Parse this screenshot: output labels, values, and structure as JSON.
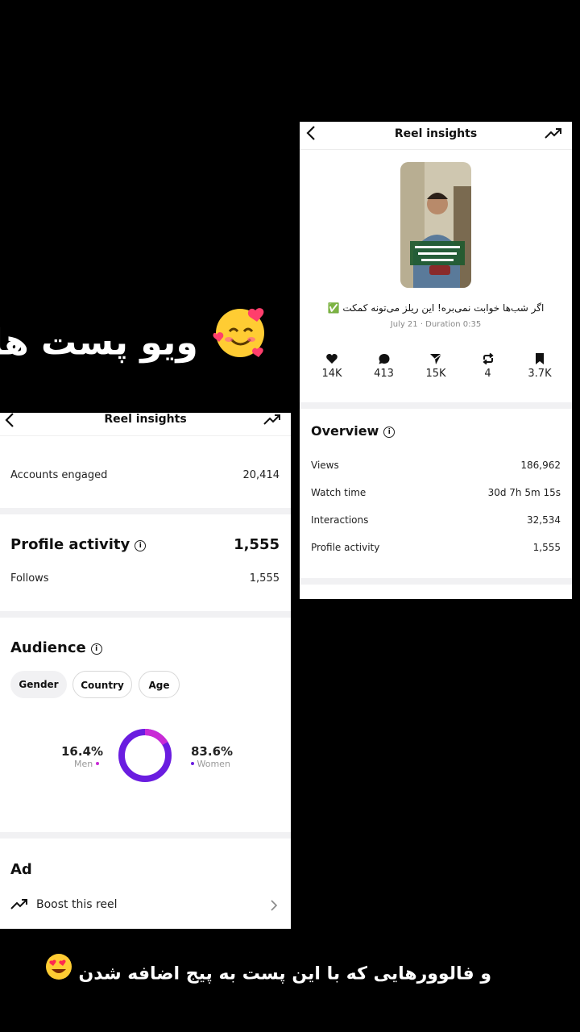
{
  "overlay": {
    "top_caption": "ویو پست ها",
    "bottom_caption": "و فالوورهایی که با این پست به پیج اضافه شدن"
  },
  "right_card": {
    "title": "Reel insights",
    "reel_caption": "اگر شب‌ها خوابت نمی‌بره! این ریلز می‌تونه کمکت ✅",
    "reel_meta": "July 21 · Duration 0:35",
    "metrics": [
      {
        "icon": "heart-icon",
        "value": "14K"
      },
      {
        "icon": "comment-icon",
        "value": "413"
      },
      {
        "icon": "share-icon",
        "value": "15K"
      },
      {
        "icon": "repost-icon",
        "value": "4"
      },
      {
        "icon": "bookmark-icon",
        "value": "3.7K"
      }
    ],
    "overview": {
      "title": "Overview",
      "rows": [
        {
          "label": "Views",
          "value": "186,962"
        },
        {
          "label": "Watch time",
          "value": "30d 7h 5m 15s"
        },
        {
          "label": "Interactions",
          "value": "32,534"
        },
        {
          "label": "Profile activity",
          "value": "1,555"
        }
      ]
    }
  },
  "left_card": {
    "title": "Reel insights",
    "accounts_engaged": {
      "label": "Accounts engaged",
      "value": "20,414"
    },
    "profile_activity": {
      "title": "Profile activity",
      "total": "1,555",
      "follows_label": "Follows",
      "follows_value": "1,555"
    },
    "audience": {
      "title": "Audience",
      "tabs": [
        "Gender",
        "Country",
        "Age"
      ],
      "selected_tab": "Gender",
      "men_pct": "16.4%",
      "men_label": "Men",
      "women_pct": "83.6%",
      "women_label": "Women",
      "men_fraction": 0.164,
      "women_fraction": 0.836,
      "men_color": "#c92bd6",
      "women_color": "#6a1de0"
    },
    "ad": {
      "title": "Ad",
      "boost_label": "Boost this reel"
    }
  }
}
